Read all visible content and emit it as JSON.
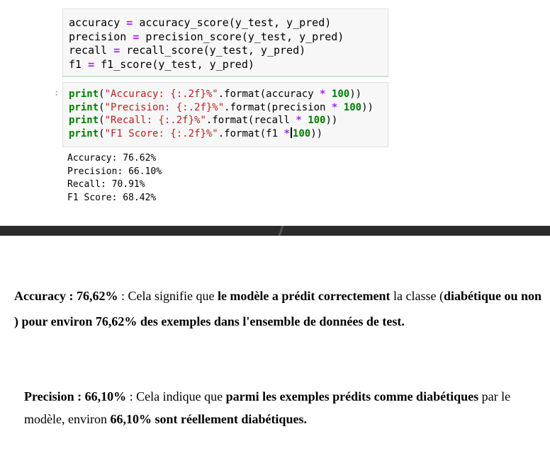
{
  "code_cell_1": {
    "lines": [
      {
        "var": "accuracy",
        "op": "=",
        "rhs": "accuracy_score(y_test, y_pred)"
      },
      {
        "var": "precision",
        "op": "=",
        "rhs": "precision_score(y_test, y_pred)"
      },
      {
        "var": "recall",
        "op": "=",
        "rhs": "recall_score(y_test, y_pred)"
      },
      {
        "var": "f1",
        "op": "=",
        "rhs": "f1_score(y_test, y_pred)"
      }
    ]
  },
  "code_cell_2": {
    "prompt": ":",
    "lines": [
      {
        "fn": "print",
        "open": "(",
        "str": "\"Accuracy: {:.2f}%\"",
        "mid": ".format(accuracy ",
        "op": "*",
        "num": "100",
        "close": "))"
      },
      {
        "fn": "print",
        "open": "(",
        "str": "\"Precision: {:.2f}%\"",
        "mid": ".format(precision ",
        "op": "*",
        "num": "100",
        "close": "))"
      },
      {
        "fn": "print",
        "open": "(",
        "str": "\"Recall: {:.2f}%\"",
        "mid": ".format(recall ",
        "op": "*",
        "num": "100",
        "close": "))"
      },
      {
        "fn": "print",
        "open": "(",
        "str": "\"F1 Score: {:.2f}%\"",
        "mid": ".format(f1 ",
        "op": "*",
        "num": "100",
        "close": "))"
      }
    ]
  },
  "output": [
    "Accuracy: 76.62%",
    "Precision: 66.10%",
    "Recall: 70.91%",
    "F1 Score: 68.42%"
  ],
  "paragraph1": {
    "b1": "Accuracy : 76,62%",
    "t1": " : Cela signifie que ",
    "b2": "le modèle a prédit correctement",
    "t2": " la classe (",
    "b3": "diabétique ou non ) pour environ 76,62% des exemples dans l'ensemble de données de test."
  },
  "paragraph2": {
    "b1": "Precision : 66,10%",
    "t1": " : Cela indique que ",
    "b2": "parmi les exemples prédits comme diabétiques",
    "t2": " par le modèle, environ ",
    "b3": "66,10% sont réellement diabétiques."
  }
}
